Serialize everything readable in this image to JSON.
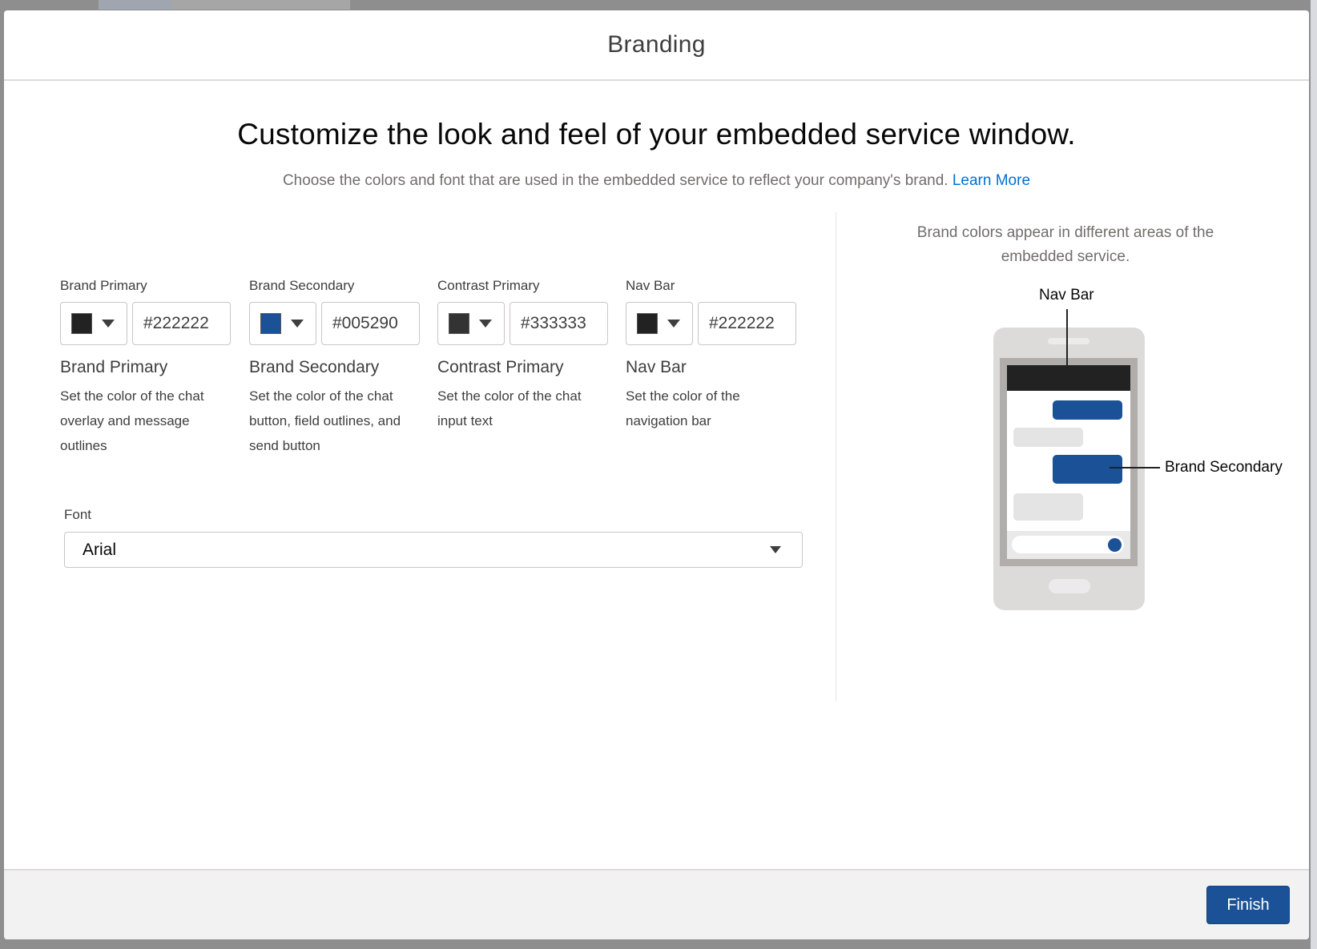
{
  "modal": {
    "title": "Branding"
  },
  "intro": {
    "headline": "Customize the look and feel of your embedded service window.",
    "subline": "Choose the colors and font that are used in the embedded service to reflect your company's brand.",
    "learn_more": "Learn More"
  },
  "colors": [
    {
      "label": "Brand Primary",
      "value": "#222222",
      "swatch": "#222222",
      "title": "Brand Primary",
      "description": "Set the color of the chat overlay and message outlines"
    },
    {
      "label": "Brand Secondary",
      "value": "#005290",
      "swatch": "#1b5297",
      "title": "Brand Secondary",
      "description": "Set the color of the chat button, field outlines, and send button"
    },
    {
      "label": "Contrast Primary",
      "value": "#333333",
      "swatch": "#333333",
      "title": "Contrast Primary",
      "description": "Set the color of the chat input text"
    },
    {
      "label": "Nav Bar",
      "value": "#222222",
      "swatch": "#222222",
      "title": "Nav Bar",
      "description": "Set the color of the navigation bar"
    }
  ],
  "font": {
    "label": "Font",
    "value": "Arial"
  },
  "preview": {
    "caption": "Brand colors appear in different areas of the embedded service.",
    "callout_nav": "Nav Bar",
    "callout_secondary": "Brand Secondary"
  },
  "footer": {
    "finish_label": "Finish"
  }
}
